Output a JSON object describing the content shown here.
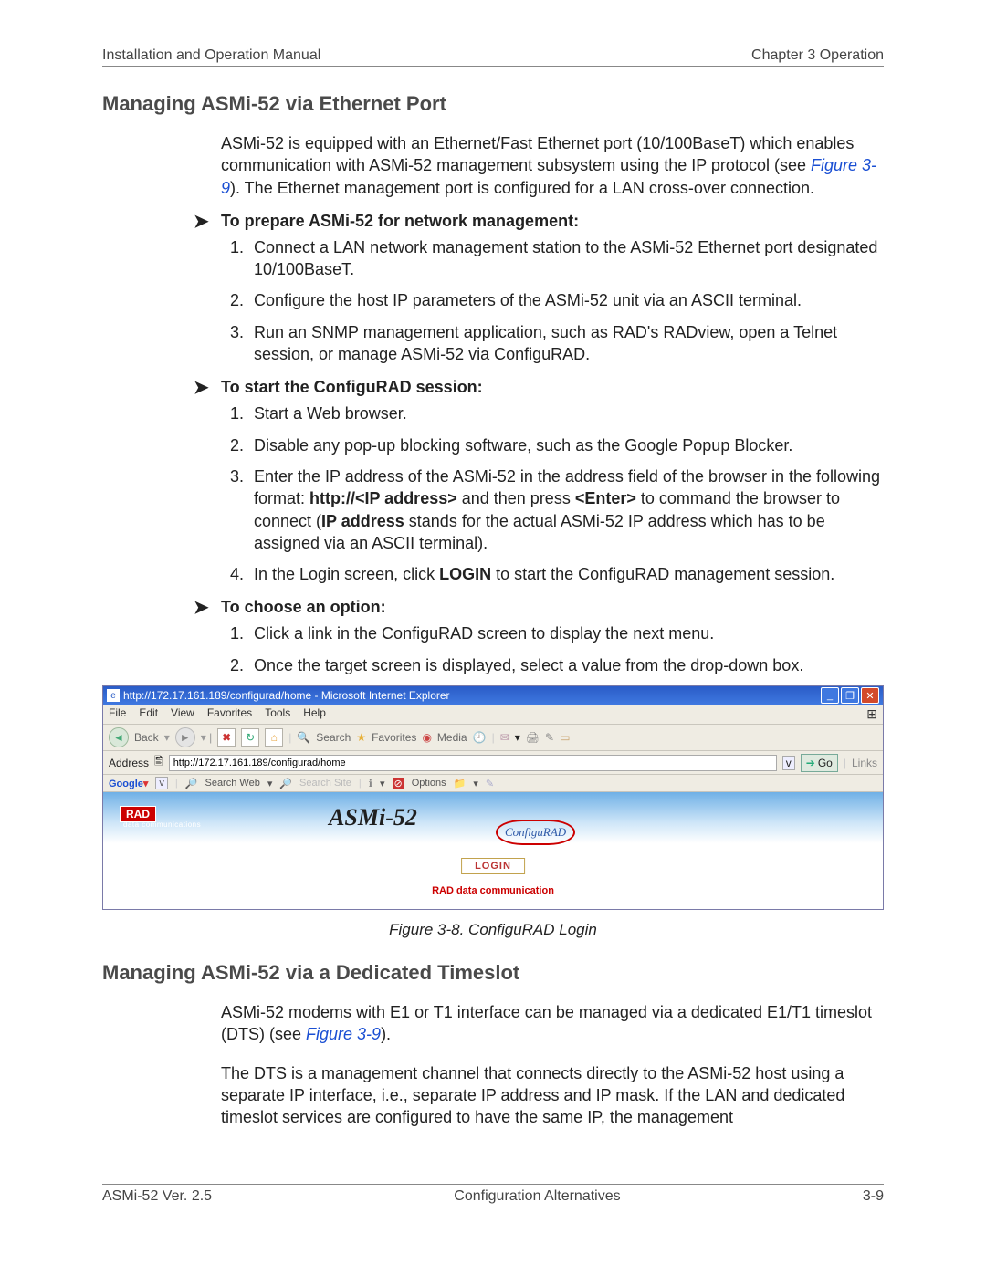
{
  "header": {
    "left": "Installation and Operation Manual",
    "right": "Chapter 3  Operation"
  },
  "section1": {
    "title": "Managing ASMi-52 via Ethernet Port",
    "intro_a": "ASMi-52 is equipped with an Ethernet/Fast Ethernet port (10/100BaseT) which enables communication with ASMi-52 management subsystem using the IP protocol (see ",
    "intro_link": "Figure 3-9",
    "intro_b": "). The Ethernet management port is configured for a LAN cross-over connection."
  },
  "proc1": {
    "title": "To prepare ASMi-52 for network management:",
    "steps": [
      "Connect a LAN network management station to the ASMi-52 Ethernet port designated 10/100BaseT.",
      "Configure the host IP parameters of the ASMi-52 unit via an ASCII terminal.",
      "Run an SNMP management application, such as RAD's RADview, open a Telnet session, or manage ASMi-52 via ConfiguRAD."
    ]
  },
  "proc2": {
    "title": "To start the ConfiguRAD session:",
    "s1": "Start a Web browser.",
    "s2": "Disable any pop-up blocking software, such as the Google Popup Blocker.",
    "s3_a": "Enter the IP address of the ASMi-52 in the address field of the browser in the following format: ",
    "s3_b": "http://<IP address>",
    "s3_c": " and then press ",
    "s3_d": "<Enter>",
    "s3_e": " to command the browser to connect (",
    "s3_f": "IP address",
    "s3_g": " stands for the actual ASMi-52 IP address which has to be assigned via an ASCII terminal).",
    "s4_a": "In the Login screen, click ",
    "s4_b": "LOGIN",
    "s4_c": " to start the ConfiguRAD management session."
  },
  "proc3": {
    "title": "To choose an option:",
    "steps": [
      "Click a link in the ConfiguRAD screen to display the next menu.",
      "Once the target screen is displayed, select a value from the drop-down box."
    ]
  },
  "ie": {
    "title": "http://172.17.161.189/configurad/home - Microsoft Internet Explorer",
    "menu": [
      "File",
      "Edit",
      "View",
      "Favorites",
      "Tools",
      "Help"
    ],
    "back": "Back",
    "search": "Search",
    "fav": "Favorites",
    "media": "Media",
    "addr_label": "Address",
    "addr_value": "http://172.17.161.189/configurad/home",
    "go": "Go",
    "links": "Links",
    "google": "Google",
    "searchweb": "Search Web",
    "searchsite": "Search Site",
    "options": "Options",
    "rad": "RAD",
    "radsub": "data communications",
    "asmi": "ASMi-52",
    "configu": "ConfiguRAD",
    "login": "LOGIN",
    "raddata": "RAD data communication"
  },
  "figcaption": "Figure 3-8.  ConfiguRAD Login",
  "section2": {
    "title": "Managing ASMi-52 via a Dedicated Timeslot",
    "p1_a": "ASMi-52 modems with E1 or T1 interface can be managed via a dedicated E1/T1 timeslot (DTS) (see ",
    "p1_link": "Figure 3-9",
    "p1_b": ").",
    "p2": "The DTS is a management channel that connects directly to the ASMi-52 host using a separate IP interface, i.e., separate IP address and IP mask. If the LAN and dedicated timeslot services are configured to have the same IP, the management"
  },
  "footer": {
    "left": "ASMi-52 Ver. 2.5",
    "center": "Configuration Alternatives",
    "right": "3-9"
  }
}
